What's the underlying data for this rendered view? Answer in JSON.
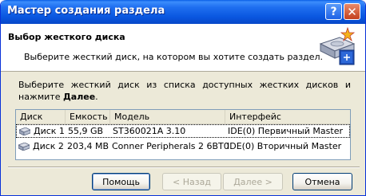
{
  "window": {
    "title": "Мастер создания раздела"
  },
  "title_buttons": {
    "help": "?",
    "close": "✕"
  },
  "header": {
    "title": "Выбор жесткого диска",
    "subtitle": "Выберите жесткий диск, на котором вы хотите создать раздел."
  },
  "instruction": {
    "text": "Выберите жесткий диск из списка доступных жестких дисков и нажмите",
    "bold": "Далее",
    "end": "."
  },
  "table": {
    "columns": [
      "Диск",
      "Емкость",
      "Модель",
      "Интерфейс"
    ],
    "rows": [
      {
        "disk": "Диск 1",
        "capacity": "55,9 GB",
        "model": "ST360021A 3.10",
        "interface": "IDE(0) Первичный Master",
        "selected": true
      },
      {
        "disk": "Диск 2",
        "capacity": "203,4 MB",
        "model": "Conner Peripherals 2 6BT0",
        "interface": "IDE(0) Вторичный Master",
        "selected": false
      }
    ]
  },
  "buttons": {
    "help": "Помощь",
    "back": "< Назад",
    "next": "Далее >",
    "cancel": "Отмена"
  },
  "colors": {
    "titlebar": "#0a57e0",
    "dialog_bg": "#ece9d8",
    "list_border": "#7f9db9"
  }
}
